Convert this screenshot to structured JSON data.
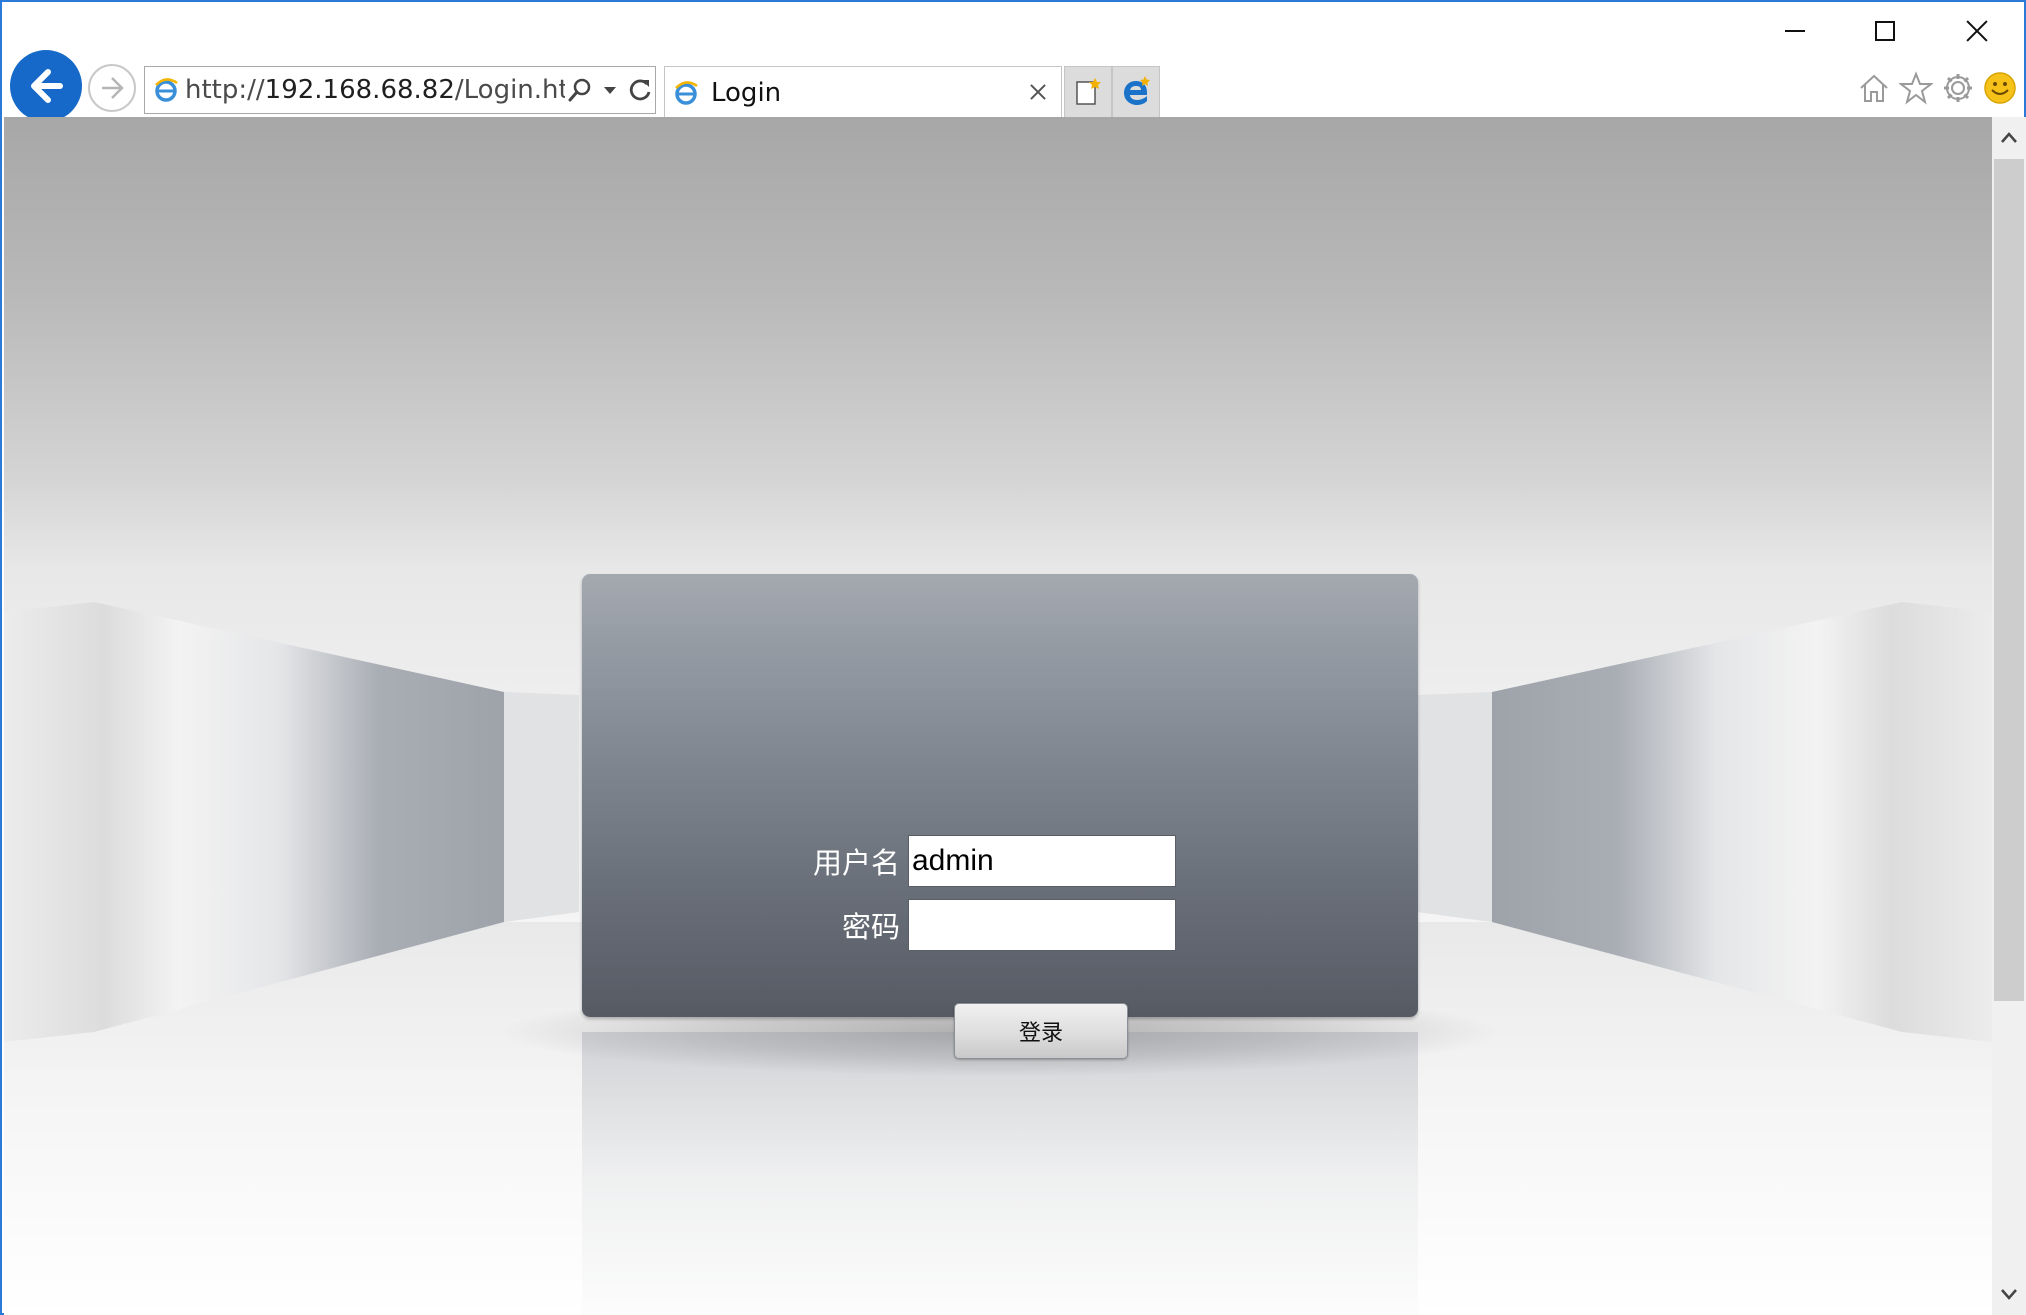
{
  "browser": {
    "address_bar": {
      "url_prefix": "http://",
      "url_host": "192.168.68.82",
      "url_path": "/Login.htm"
    },
    "tab": {
      "title": "Login"
    },
    "icons": {
      "back": "back-arrow-icon",
      "forward": "forward-arrow-icon",
      "search": "search-icon",
      "dropdown": "chevron-down-icon",
      "refresh": "refresh-icon",
      "page": "ie-page-icon",
      "new_tab": "new-tab-icon",
      "edge": "edge-icon",
      "home": "home-icon",
      "favorites": "star-icon",
      "tools": "gear-icon",
      "feedback": "smiley-icon"
    },
    "colors": {
      "window_border": "#2b79d8",
      "back_button": "#1669c8"
    }
  },
  "login": {
    "username_label": "用户名",
    "username_value": "admin",
    "password_label": "密码",
    "password_value": "",
    "submit_label": "登录"
  }
}
